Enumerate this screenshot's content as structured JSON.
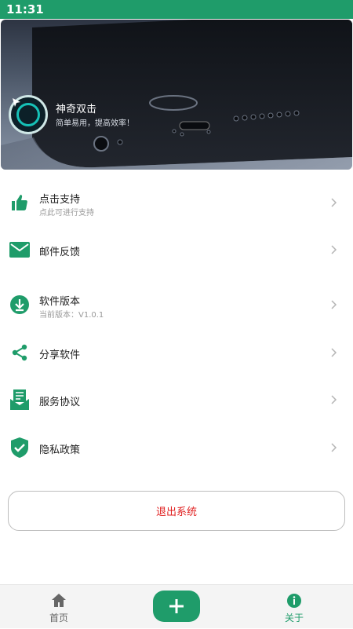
{
  "status_bar": {
    "time": "11:31"
  },
  "hero": {
    "app_name": "神奇双击",
    "slogan": "简单易用，提高效率！"
  },
  "menu": {
    "items": [
      {
        "label": "点击支持",
        "sub": "点此可进行支持",
        "icon": "thumbs-up-icon"
      },
      {
        "label": "邮件反馈",
        "sub": "",
        "icon": "mail-icon"
      },
      {
        "label": "软件版本",
        "sub": "当前版本：V1.0.1",
        "icon": "download-icon"
      },
      {
        "label": "分享软件",
        "sub": "",
        "icon": "share-icon"
      },
      {
        "label": "服务协议",
        "sub": "",
        "icon": "agreement-icon"
      },
      {
        "label": "隐私政策",
        "sub": "",
        "icon": "shield-check-icon"
      }
    ]
  },
  "logout": {
    "label": "退出系统"
  },
  "tabbar": {
    "home_label": "首页",
    "about_label": "关于",
    "add_icon": "plus-icon"
  },
  "colors": {
    "accent": "#1f9c6a",
    "danger": "#e02020",
    "active_tab": "#1f9c6a",
    "inactive_tab": "#666666"
  }
}
